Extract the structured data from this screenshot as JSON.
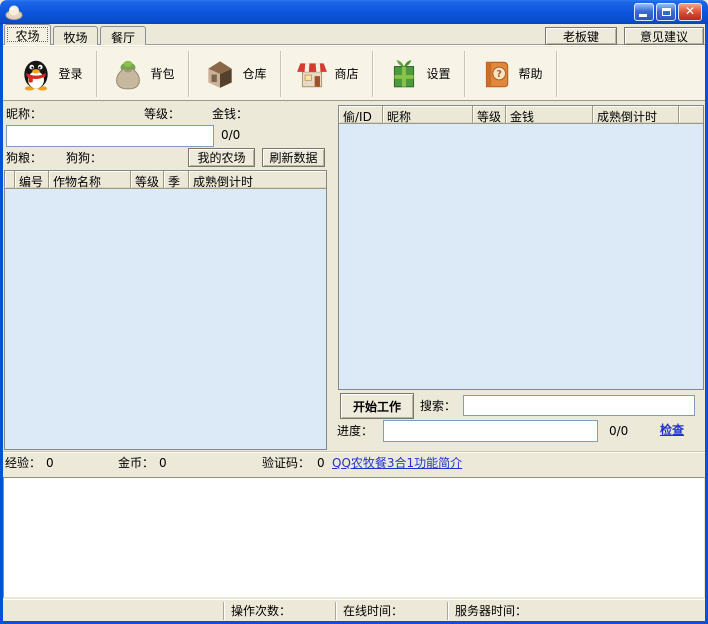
{
  "window": {
    "app_icon": "farm-hat",
    "controls": {
      "minimize": "min",
      "maximize": "max",
      "close": "x"
    }
  },
  "tabs": [
    {
      "label": "农场",
      "active": true
    },
    {
      "label": "牧场",
      "active": false
    },
    {
      "label": "餐厅",
      "active": false
    }
  ],
  "top_buttons": {
    "boss_key": "老板键",
    "feedback": "意见建议"
  },
  "toolbar": {
    "items": [
      {
        "icon": "qq-penguin-icon",
        "label": "登录"
      },
      {
        "icon": "money-bag-icon",
        "label": "背包"
      },
      {
        "icon": "warehouse-icon",
        "label": "仓库"
      },
      {
        "icon": "shop-icon",
        "label": "商店"
      },
      {
        "icon": "green-box-icon",
        "label": "设置"
      },
      {
        "icon": "help-book-icon",
        "label": "帮助"
      }
    ]
  },
  "farm_panel": {
    "nickname_label": "昵称：",
    "level_label": "等级：",
    "money_label": "金钱：",
    "nickname_value": "",
    "money_value": "0/0",
    "dogfood_label": "狗粮：",
    "dog_label": "狗狗：",
    "my_farm_button": "我的农场",
    "refresh_button": "刷新数据",
    "crops_table": {
      "columns": [
        "编号",
        "作物名称",
        "等级",
        "季",
        "成熟倒计时"
      ],
      "rows": []
    }
  },
  "friends_panel": {
    "table": {
      "columns": [
        "偷/ID",
        "昵称",
        "等级",
        "金钱",
        "成熟倒计时"
      ],
      "rows": []
    },
    "start_work_button": "开始工作",
    "search_label": "搜索：",
    "search_value": "",
    "progress_label": "进度：",
    "progress_value": "",
    "progress_count": "0/0",
    "check_link": "检查"
  },
  "stats": {
    "exp_label": "经验：",
    "exp_value": "0",
    "gold_label": "金币：",
    "gold_value": "0",
    "captcha_label": "验证码：",
    "captcha_value": "0",
    "intro_link": "QQ农牧餐3合1功能简介"
  },
  "log": {
    "content": ""
  },
  "statusbar": {
    "ops_label": "操作次数：",
    "online_label": "在线时间：",
    "server_label": "服务器时间："
  },
  "colors": {
    "titlebar_blue": "#0D55DE",
    "window_border_blue": "#0850D8",
    "body_beige": "#ECE9D8",
    "toolbar_cream": "#F7F4E7",
    "table_body_blue": "#DCE9F6",
    "link_blue": "#2233CC",
    "close_red": "#C23318",
    "input_border": "#7F9DB9"
  }
}
